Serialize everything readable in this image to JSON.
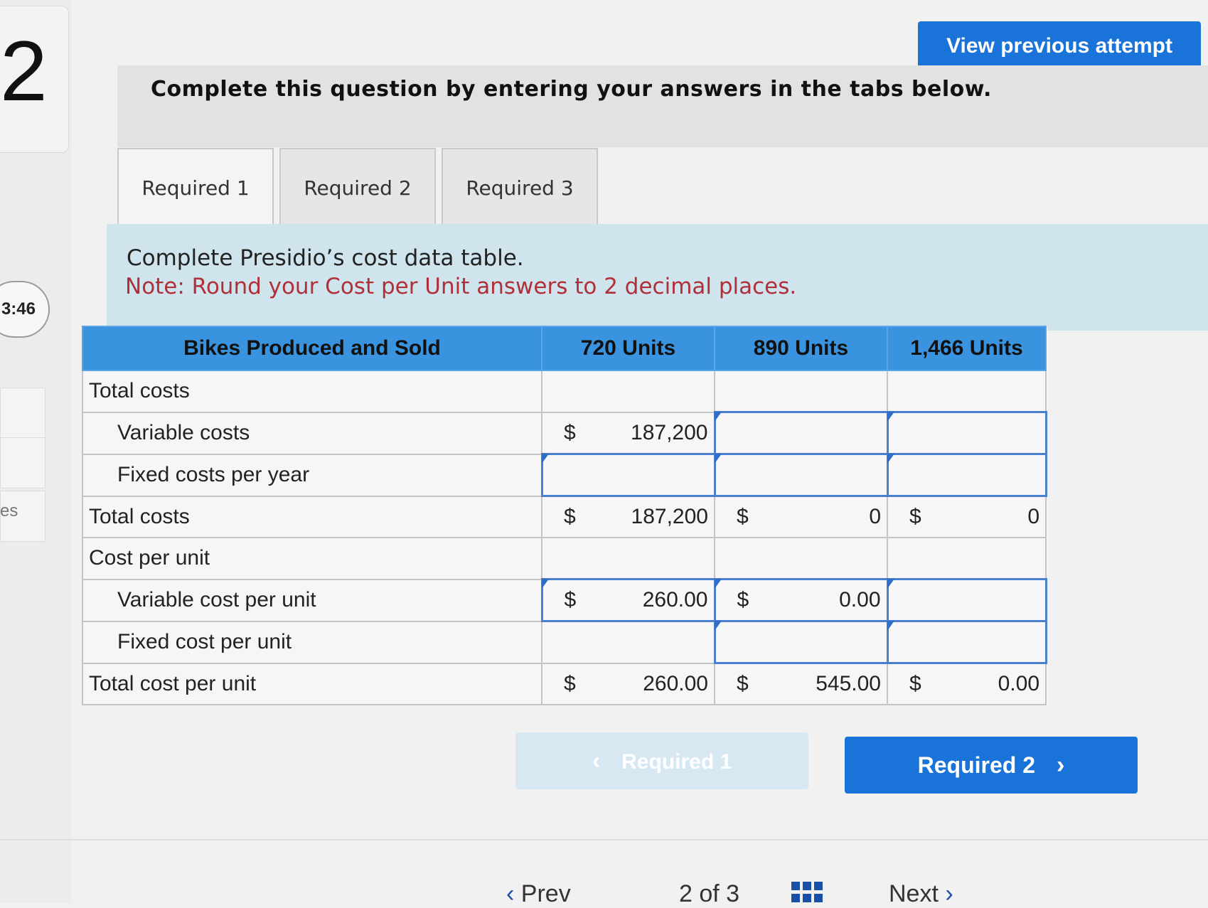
{
  "sidebar": {
    "question_number": "2",
    "timer": "3:46",
    "side_label": "es"
  },
  "header": {
    "view_previous_label": "View previous attempt",
    "instruction": "Complete this question by entering your answers in the tabs below."
  },
  "tabs": [
    {
      "label": "Required 1"
    },
    {
      "label": "Required 2"
    },
    {
      "label": "Required 3"
    }
  ],
  "prompt": {
    "text": "Complete Presidio’s cost data table.",
    "note": "Note: Round your Cost per Unit answers to 2 decimal places."
  },
  "table": {
    "headers": [
      "Bikes Produced and Sold",
      "720 Units",
      "890 Units",
      "1,466 Units"
    ],
    "rows": [
      {
        "label": "Total costs",
        "indent": false,
        "cells": [
          {
            "d": "",
            "v": ""
          },
          {
            "d": "",
            "v": ""
          },
          {
            "d": "",
            "v": ""
          }
        ]
      },
      {
        "label": "Variable costs",
        "indent": true,
        "cells": [
          {
            "d": "$",
            "v": "187,200"
          },
          {
            "d": "",
            "v": ""
          },
          {
            "d": "",
            "v": ""
          }
        ]
      },
      {
        "label": "Fixed costs per year",
        "indent": true,
        "cells": [
          {
            "d": "",
            "v": ""
          },
          {
            "d": "",
            "v": ""
          },
          {
            "d": "",
            "v": ""
          }
        ]
      },
      {
        "label": "Total costs",
        "indent": false,
        "cells": [
          {
            "d": "$",
            "v": "187,200"
          },
          {
            "d": "$",
            "v": "0"
          },
          {
            "d": "$",
            "v": "0"
          }
        ]
      },
      {
        "label": "Cost per unit",
        "indent": false,
        "cells": [
          {
            "d": "",
            "v": ""
          },
          {
            "d": "",
            "v": ""
          },
          {
            "d": "",
            "v": ""
          }
        ]
      },
      {
        "label": "Variable cost per unit",
        "indent": true,
        "cells": [
          {
            "d": "$",
            "v": "260.00"
          },
          {
            "d": "$",
            "v": "0.00"
          },
          {
            "d": "",
            "v": ""
          }
        ]
      },
      {
        "label": "Fixed cost per unit",
        "indent": true,
        "cells": [
          {
            "d": "",
            "v": ""
          },
          {
            "d": "",
            "v": ""
          },
          {
            "d": "",
            "v": ""
          }
        ]
      },
      {
        "label": "Total cost per unit",
        "indent": false,
        "cells": [
          {
            "d": "$",
            "v": "260.00"
          },
          {
            "d": "$",
            "v": "545.00"
          },
          {
            "d": "$",
            "v": "0.00"
          }
        ]
      }
    ]
  },
  "nav": {
    "prev_required_label": "Required 1",
    "next_required_label": "Required 2",
    "prev_label": "Prev",
    "page_indicator": "2 of 3",
    "next_label": "Next"
  }
}
